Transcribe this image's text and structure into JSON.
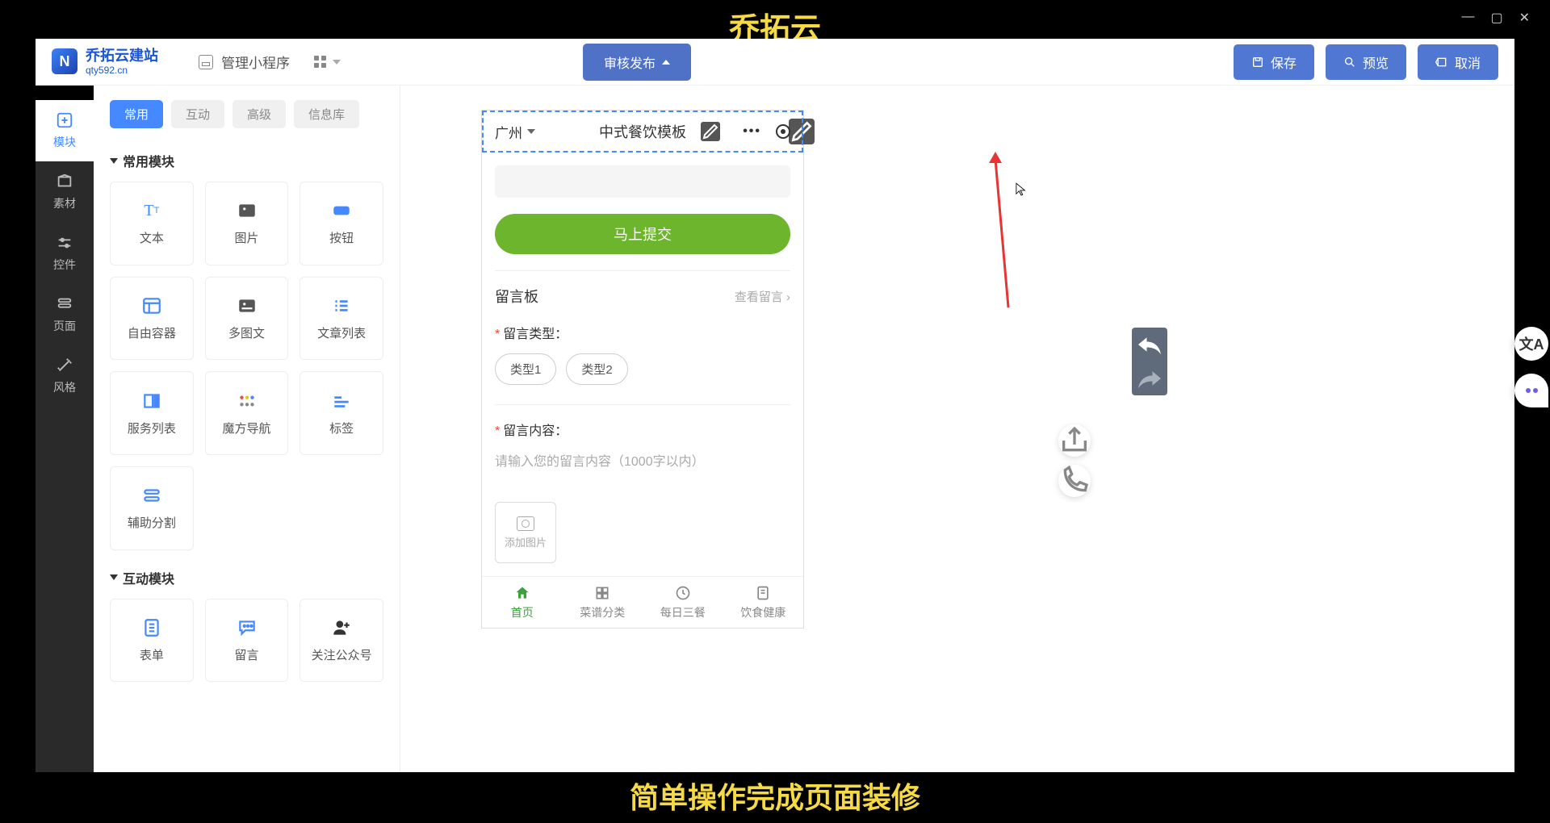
{
  "banners": {
    "top": "乔拓云",
    "bottom": "简单操作完成页面装修"
  },
  "header": {
    "logo_title": "乔拓云建站",
    "logo_sub": "qty592.cn",
    "manage": "管理小程序",
    "publish": "审核发布",
    "save": "保存",
    "preview": "预览",
    "cancel": "取消"
  },
  "rail": {
    "items": [
      {
        "label": "模块"
      },
      {
        "label": "素材"
      },
      {
        "label": "控件"
      },
      {
        "label": "页面"
      },
      {
        "label": "风格"
      }
    ]
  },
  "panel": {
    "tabs": {
      "t0": "常用",
      "t1": "互动",
      "t2": "高级",
      "t3": "信息库"
    },
    "sec_common": "常用模块",
    "sec_interact": "互动模块",
    "m": {
      "text": "文本",
      "image": "图片",
      "button": "按钮",
      "free": "自由容器",
      "imgtxt": "多图文",
      "article": "文章列表",
      "svc": "服务列表",
      "magic": "魔方导航",
      "tags": "标签",
      "div": "辅助分割",
      "form": "表单",
      "comment": "留言",
      "wechat": "关注公众号"
    }
  },
  "phone": {
    "city": "广州",
    "title": "中式餐饮模板",
    "submit": "马上提交",
    "board_title": "留言板",
    "board_see": "查看留言",
    "type_label": "留言类型：",
    "type1": "类型1",
    "type2": "类型2",
    "content_label": "留言内容：",
    "content_ph": "请输入您的留言内容（1000字以内）",
    "add_image": "添加图片",
    "nav": {
      "home": "首页",
      "menu": "菜谱分类",
      "daily": "每日三餐",
      "health": "饮食健康"
    }
  }
}
